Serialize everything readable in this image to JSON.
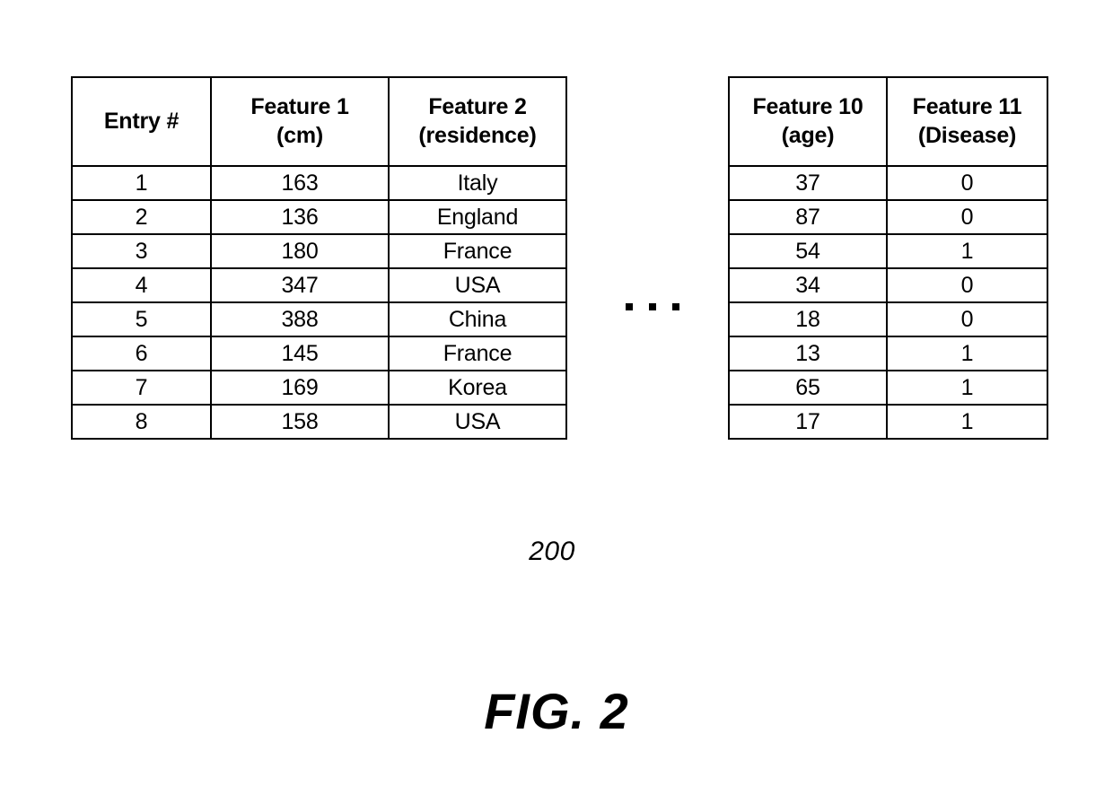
{
  "figure": {
    "caption": "FIG. 2",
    "reference_numeral": "200",
    "ellipsis": "..."
  },
  "tables": {
    "left": {
      "name": "feature-table-left",
      "headers": [
        {
          "line1": "Entry #",
          "line2": ""
        },
        {
          "line1": "Feature 1",
          "line2": "(cm)"
        },
        {
          "line1": "Feature 2",
          "line2": "(residence)"
        }
      ],
      "rows": [
        {
          "entry": "1",
          "feature1": "163",
          "feature2": "Italy"
        },
        {
          "entry": "2",
          "feature1": "136",
          "feature2": "England"
        },
        {
          "entry": "3",
          "feature1": "180",
          "feature2": "France"
        },
        {
          "entry": "4",
          "feature1": "347",
          "feature2": "USA"
        },
        {
          "entry": "5",
          "feature1": "388",
          "feature2": "China"
        },
        {
          "entry": "6",
          "feature1": "145",
          "feature2": "France"
        },
        {
          "entry": "7",
          "feature1": "169",
          "feature2": "Korea"
        },
        {
          "entry": "8",
          "feature1": "158",
          "feature2": "USA"
        }
      ]
    },
    "right": {
      "name": "feature-table-right",
      "headers": [
        {
          "line1": "Feature 10",
          "line2": "(age)"
        },
        {
          "line1": "Feature 11",
          "line2": "(Disease)"
        }
      ],
      "rows": [
        {
          "feature10": "37",
          "feature11": "0"
        },
        {
          "feature10": "87",
          "feature11": "0"
        },
        {
          "feature10": "54",
          "feature11": "1"
        },
        {
          "feature10": "34",
          "feature11": "0"
        },
        {
          "feature10": "18",
          "feature11": "0"
        },
        {
          "feature10": "13",
          "feature11": "1"
        },
        {
          "feature10": "65",
          "feature11": "1"
        },
        {
          "feature10": "17",
          "feature11": "1"
        }
      ]
    }
  },
  "colors": {
    "line": "#000000",
    "text": "#000000",
    "background": "#ffffff"
  }
}
